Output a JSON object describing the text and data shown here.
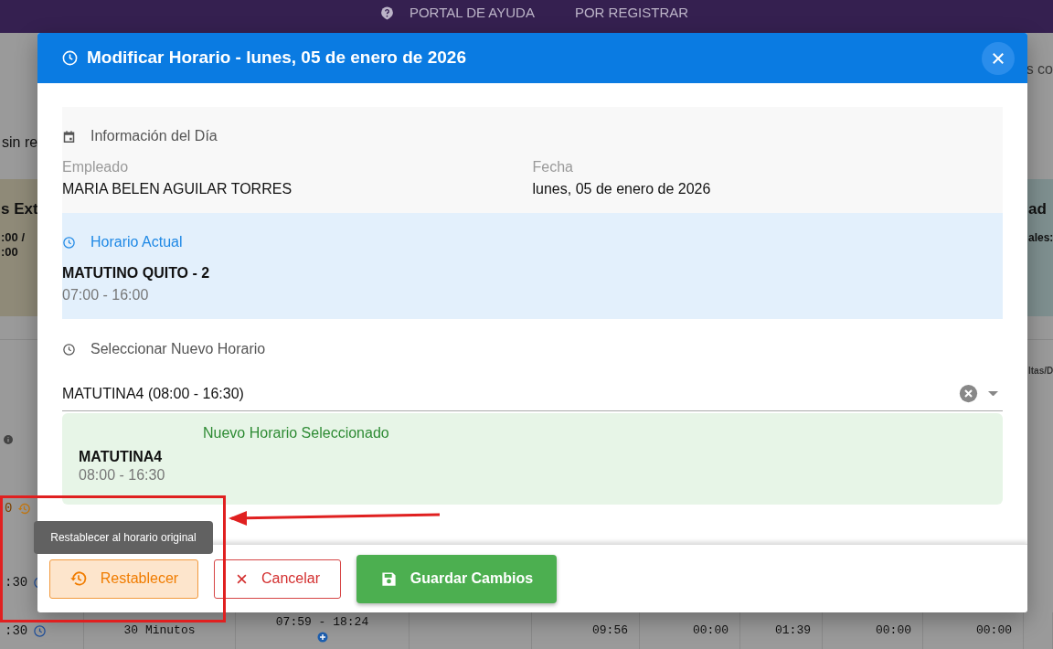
{
  "navbar": {
    "items": [
      {
        "label": "PORTAL DE AYUDA"
      },
      {
        "label": "POR REGISTRAR"
      }
    ]
  },
  "background": {
    "top_right_text": "s co",
    "left_note": "sin re",
    "left_card": {
      "title": "s Ext",
      "lines": [
        ":00 /",
        ":00"
      ]
    },
    "right_card": {
      "title": "ad",
      "line": "ales:"
    },
    "table_header_fragment": "ltas/D",
    "side_cells": [
      {
        "text": "0",
        "kind": "history"
      },
      {
        "text": ":30",
        "kind": "clock"
      }
    ],
    "bottom_row": [
      {
        "text": ":30",
        "kind": "clock"
      },
      {
        "text": "30 Minutos"
      },
      {
        "text": "07:59 - 18:24",
        "kind": "add"
      },
      {
        "text": "09:56"
      },
      {
        "text": "00:00"
      },
      {
        "text": "01:39"
      },
      {
        "text": "00:00"
      },
      {
        "text": "00:00"
      }
    ]
  },
  "dialog": {
    "title": "Modificar Horario - lunes, 05 de enero de 2026",
    "day_info": {
      "heading": "Información del Día",
      "fields": [
        {
          "label": "Empleado",
          "value": "MARIA BELEN AGUILAR TORRES"
        },
        {
          "label": "Fecha",
          "value": "lunes, 05 de enero de 2026"
        }
      ]
    },
    "current_schedule": {
      "heading": "Horario Actual",
      "name": "MATUTINO QUITO - 2",
      "hours": "07:00 - 16:00"
    },
    "new_schedule": {
      "heading": "Seleccionar Nuevo Horario",
      "select_value": "MATUTINA4 (08:00 - 16:30)",
      "preview": {
        "heading": "Nuevo Horario Seleccionado",
        "name": "MATUTINA4",
        "hours": "08:00 - 16:30"
      }
    },
    "buttons": [
      {
        "label": "Restablecer",
        "kind": "reset"
      },
      {
        "label": "Cancelar",
        "kind": "cancel"
      },
      {
        "label": "Guardar Cambios",
        "kind": "save"
      }
    ],
    "tooltip": "Restablecer al horario original"
  }
}
